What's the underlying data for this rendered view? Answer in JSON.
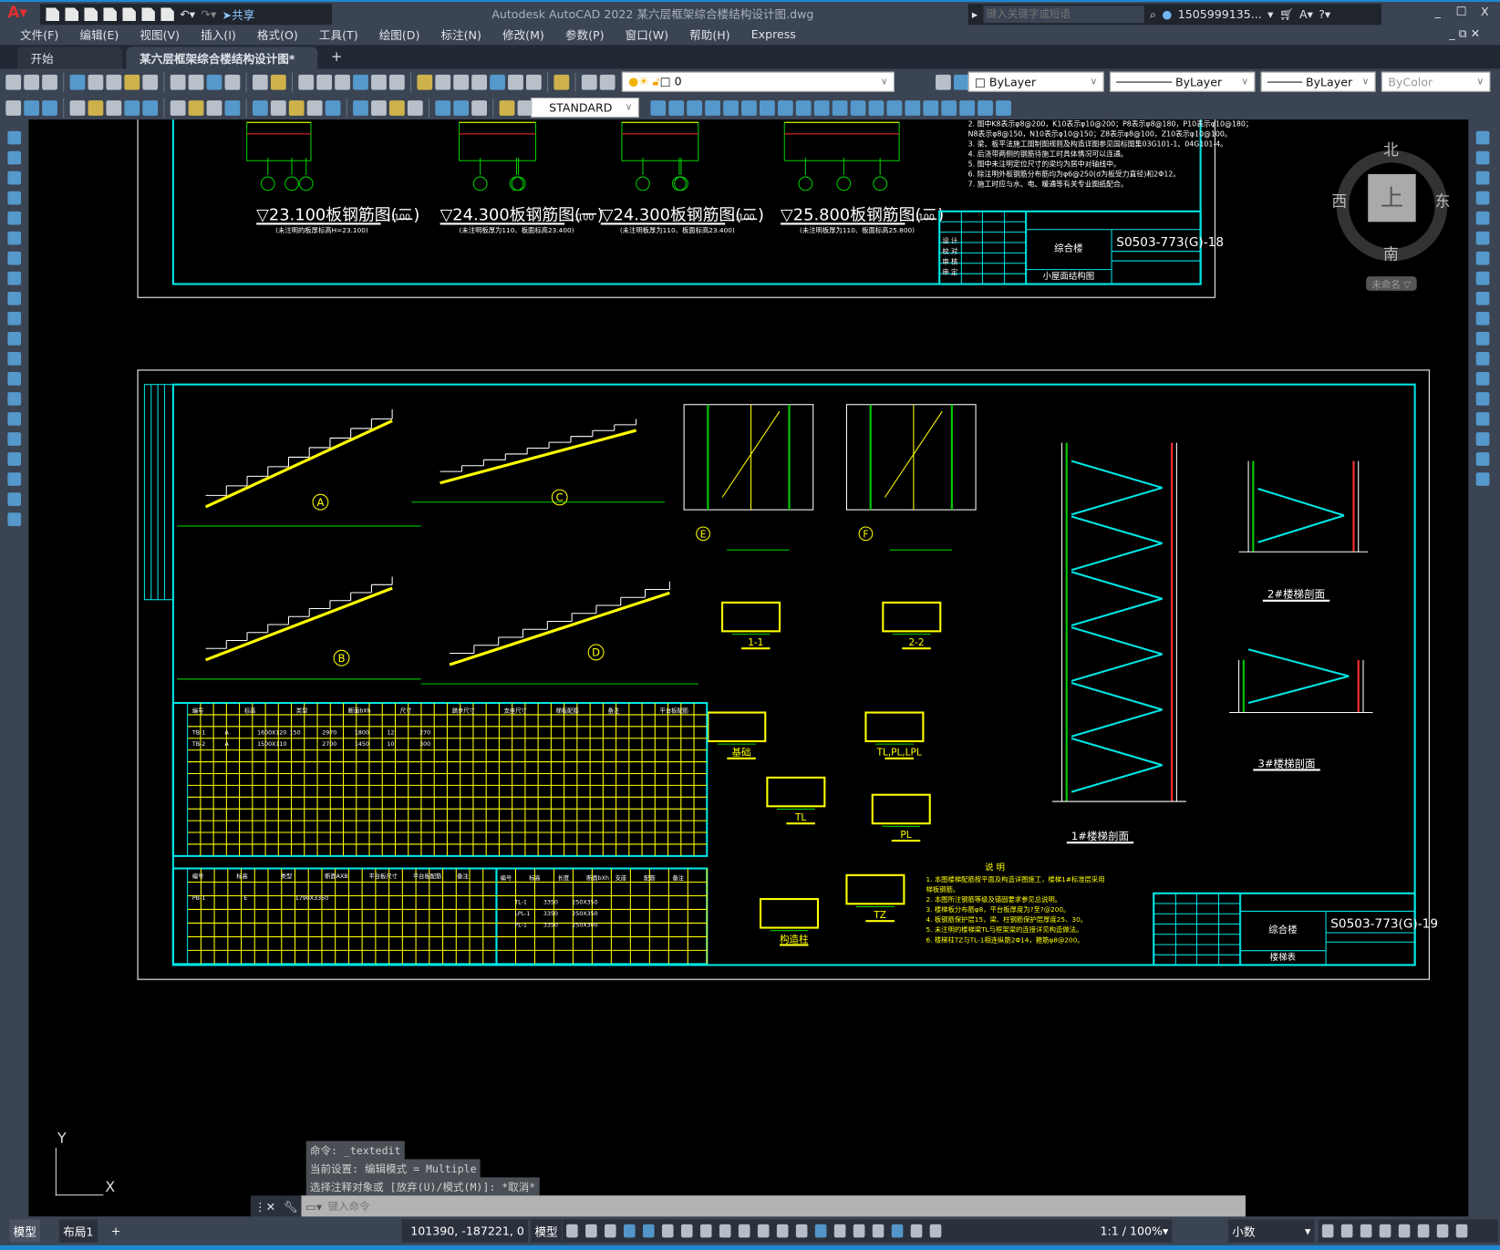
{
  "window": {
    "title": "Autodesk AutoCAD 2022    某六层框架综合楼结构设计图.dwg",
    "share": "共享",
    "search_placeholder": "键入关键字或短语",
    "user": "1505999135...",
    "minimize": "_",
    "maximize": "□",
    "close": "X"
  },
  "menu": [
    "文件(F)",
    "编辑(E)",
    "视图(V)",
    "插入(I)",
    "格式(O)",
    "工具(T)",
    "绘图(D)",
    "标注(N)",
    "修改(M)",
    "参数(P)",
    "窗口(W)",
    "帮助(H)",
    "Express"
  ],
  "tabs": {
    "start": "开始",
    "doc": "某六层框架综合楼结构设计图*",
    "add": "+"
  },
  "toolbar": {
    "layer": "0",
    "textstyle": "STANDARD",
    "color": "ByLayer",
    "linetype": "ByLayer",
    "lineweight": "ByLayer",
    "plotstyle": "ByColor"
  },
  "viewcube": {
    "north": "北",
    "south": "南",
    "west": "西",
    "east": "东",
    "top": "上",
    "ucs": "未命名"
  },
  "drawing": {
    "upper_titles": [
      {
        "title": "▽23.100板钢筋图(二)",
        "scale": "1:100",
        "sub": "(未注明的板厚标高H=23.100)"
      },
      {
        "title": "▽24.300板钢筋图(一)",
        "scale": "1:100",
        "sub": "(未注明板厚为110、板面标高23.400)"
      },
      {
        "title": "▽24.300板钢筋图(二)",
        "scale": "1:100",
        "sub": "(未注明板厚为110、板面标高23.400)"
      },
      {
        "title": "▽25.800板钢筋图(二)",
        "scale": "1:100",
        "sub": "(未注明板厚为110、板面标高25.800)"
      }
    ],
    "upper_notes": [
      "2. 图中K8表示φ8@200，K10表示φ10@200；P8表示φ8@180，P10表示φ10@180；",
      "   N8表示φ8@150，N10表示φ10@150；Z8表示φ8@100，Z10表示φ10@100。",
      "3. 梁、板平法施工图制图规则及构造详图参见国标图集03G101-1、04G101-4。",
      "4. 后浇带两侧的钢筋待施工时具体情况可以连通。",
      "5. 图中未注明定位尺寸的梁均为居中对轴线中。",
      "6. 除注明外板钢筋分布筋均为φ6@250(d为板受力直径)和2Φ12。",
      "7. 施工时应与水、电、暖通等有关专业图纸配合。"
    ],
    "upper_block": {
      "project": "综合楼",
      "number": "S0503-773(G)-18",
      "sheet": "小屋面结构图",
      "rows": [
        "设 计",
        "校 对",
        "审 核",
        "审 定"
      ]
    },
    "lower_block": {
      "project": "综合楼",
      "number": "S0503-773(G)-19",
      "sheet": "楼梯表"
    },
    "stair_labels": [
      "A",
      "B",
      "C",
      "D",
      "E",
      "F"
    ],
    "section_labels": [
      "1-1",
      "2-2",
      "TL,PL,LPL",
      "TL",
      "PL",
      "TZ",
      "基础",
      "构造柱"
    ],
    "stair_sections": [
      "1#楼梯剖面",
      "2#楼梯剖面",
      "3#楼梯剖面"
    ],
    "notes_title": "说 明",
    "notes": [
      "1. 本图楼梯配筋按平面及构造详图施工，楼梯1#标准层采用",
      "   梯板钢筋。",
      "2. 本图所注钢筋等级及锚固要求参见总说明。",
      "3. 楼梯板分布筋φ8，平台板厚度为?至?@200。",
      "4. 板钢筋保护层15，梁、柱钢筋保护层厚度25、30。",
      "5. 未注明的楼梯梁TL与框架梁的连接详见构造做法。",
      "6. 楼梯柱TZ与TL-1相连纵筋2Φ14，箍筋φ8@200。"
    ],
    "table1_headers": [
      "编号",
      "标高",
      "类型",
      "断面bXh",
      "尺寸",
      "踏步尺寸",
      "支座尺寸",
      "梯板配筋",
      "备注",
      "平台板配筋"
    ],
    "table1_rows": [
      [
        "TB-1",
        "A",
        "1600X120",
        "150",
        "2970",
        "1800",
        "12",
        "270"
      ],
      [
        "TB-2",
        "A",
        "1500X110",
        "",
        "2700",
        "1450",
        "10",
        "300"
      ]
    ],
    "table2_headers": [
      "编号",
      "标高",
      "类型",
      "断面AXB",
      "平台板尺寸",
      "平台板配筋",
      "备注",
      "编号",
      "标高",
      "长度",
      "断面bXh",
      "支座",
      "配筋",
      "备注"
    ],
    "table2_rows": [
      [
        "PB-1",
        "E",
        "1790X3350"
      ],
      [
        "TL-1",
        "3350",
        "250X350"
      ],
      [
        "LPL-1",
        "3350",
        "250X350"
      ],
      [
        "PL-1",
        "3350",
        "250X300"
      ]
    ]
  },
  "command": {
    "history": [
      "命令: _textedit",
      "当前设置: 编辑模式 = Multiple",
      "选择注释对象或 [放弃(U)/模式(M)]: *取消*"
    ],
    "placeholder": "键入命令"
  },
  "layout_tabs": [
    "模型",
    "布局1",
    "+"
  ],
  "status": {
    "coords": "101390, -187221, 0",
    "space": "模型",
    "scale": "1:1 / 100%",
    "units": "小数"
  },
  "ucs": {
    "x": "X",
    "y": "Y"
  },
  "colors": {
    "cyan": "#00e5e5",
    "yellow": "#ffff00",
    "green": "#00cc00",
    "white": "#ffffff",
    "red": "#ff3030"
  }
}
